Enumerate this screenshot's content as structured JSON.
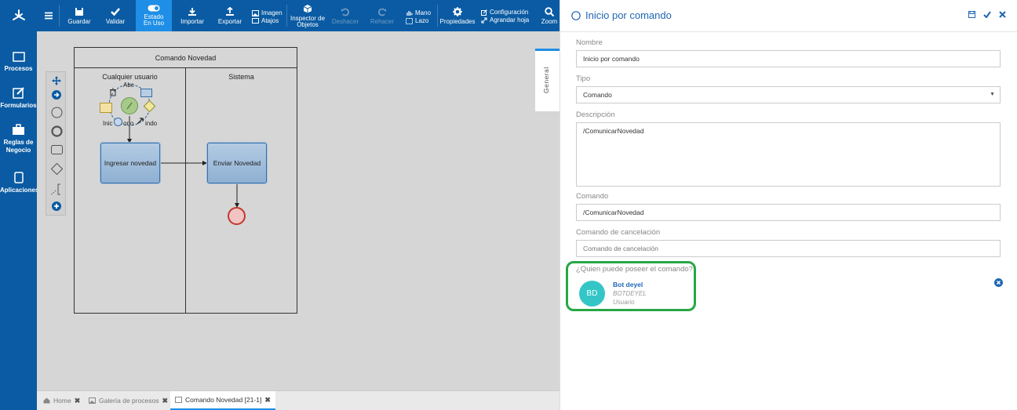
{
  "sidebar": {
    "items": [
      {
        "label": "Procesos",
        "icon": "processes-icon"
      },
      {
        "label": "Formularios",
        "icon": "forms-icon"
      },
      {
        "label": "Reglas de",
        "label2": "Negocio",
        "icon": "briefcase-icon"
      },
      {
        "label": "Aplicaciones",
        "icon": "apps-icon"
      }
    ]
  },
  "toolbar": {
    "guardar": "Guardar",
    "validar": "Validar",
    "estado_1": "Estado",
    "estado_2": "En Uso",
    "importar": "Importar",
    "exportar": "Exportar",
    "imagen": "Imagen",
    "atajos": "Atajos",
    "inspector_1": "Inspector de",
    "inspector_2": "Objetos",
    "deshacer": "Deshacer",
    "rehacer": "Rehacer",
    "mano": "Mano",
    "lazo": "Lazo",
    "propiedades": "Propiedades",
    "configuracion": "Configuración",
    "agrandar": "Agrandar hoja",
    "zoom": "Zoom"
  },
  "diagram": {
    "pool_title": "Comando Novedad",
    "lane1": "Cualquier usuario",
    "lane2": "Sistema",
    "task1": "Ingresar novedad",
    "task2": "Enviar Novedad",
    "ctx_label_top": "Abc",
    "ctx_label_left": "Inic",
    "ctx_label_mid": "orio",
    "ctx_label_right": "indo"
  },
  "tabs": [
    {
      "label": "Home"
    },
    {
      "label": "Galería de procesos"
    },
    {
      "label": "Comando Novedad [21-1]"
    }
  ],
  "side_tab": "General",
  "panel": {
    "title": "Inicio por comando",
    "nombre_label": "Nombre",
    "nombre_value": "Inicio por comando",
    "tipo_label": "Tipo",
    "tipo_value": "Comando",
    "descripcion_label": "Descripción",
    "descripcion_value": "/ComunicarNovedad",
    "comando_label": "Comando",
    "comando_value": "/ComunicarNovedad",
    "cancel_label": "Comando de cancelación",
    "cancel_placeholder": "Comando de cancelación",
    "owner_label": "¿Quien puede poseer el comando?",
    "user": {
      "initials": "BD",
      "name": "Bot deyel",
      "id": "BOTDEYEL",
      "role": "Usuario"
    }
  },
  "colors": {
    "brand": "#0a5ba3",
    "accent": "#1e8ee6",
    "highlight": "#28a745",
    "avatar": "#34c6c6"
  }
}
